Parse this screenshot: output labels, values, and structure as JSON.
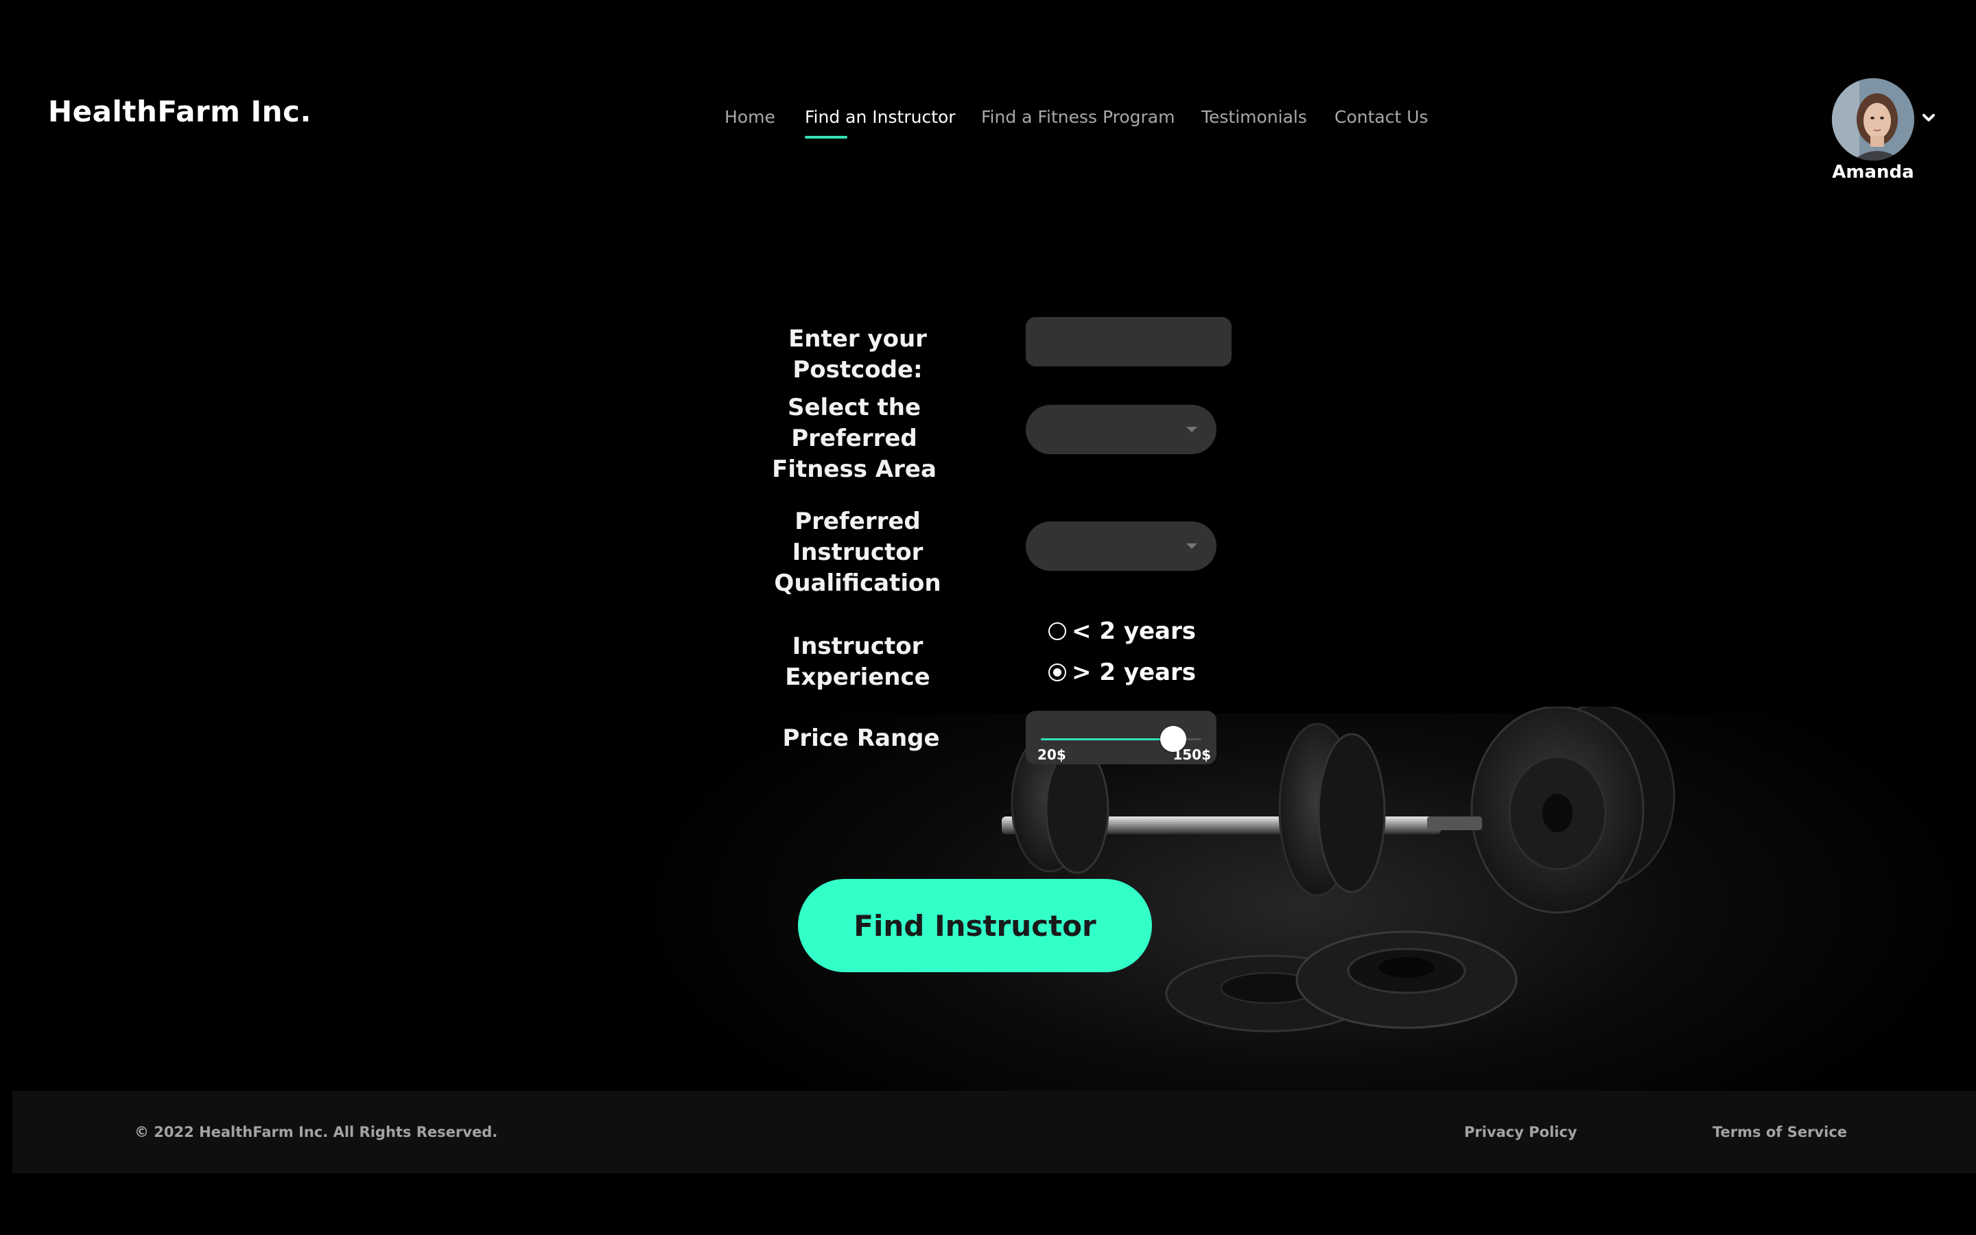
{
  "brand": {
    "name": "HealthFarm Inc."
  },
  "nav": {
    "items": [
      {
        "label": "Home",
        "active": false
      },
      {
        "label": "Find an Instructor",
        "active": true
      },
      {
        "label": "Find a Fitness Program",
        "active": false
      },
      {
        "label": "Testimonials",
        "active": false
      },
      {
        "label": "Contact Us",
        "active": false
      }
    ],
    "accent_color": "#33e0b6"
  },
  "user": {
    "name": "Amanda",
    "menu_icon": "chevron-down-icon"
  },
  "form": {
    "postcode": {
      "label": "Enter your Postcode:",
      "value": "",
      "placeholder": ""
    },
    "fitness_area": {
      "label_line1": "Select the Preferred",
      "label_line2": "Fitness Area",
      "selected": ""
    },
    "qualification": {
      "label_line1": "Preferred Instructor",
      "label_line2": "Qualification",
      "selected": ""
    },
    "experience": {
      "label": "Instructor Experience",
      "options": [
        {
          "label": "< 2 years",
          "checked": false
        },
        {
          "label": "> 2 years",
          "checked": true
        }
      ]
    },
    "price_range": {
      "label": "Price Range",
      "min_label": "20$",
      "max_label": "150$",
      "min": 20,
      "max": 150,
      "value": 127,
      "fill_color": "#33e0b6"
    },
    "submit": {
      "label": "Find Instructor",
      "color": "#33ffc9"
    }
  },
  "footer": {
    "copyright": "© 2022 HealthFarm Inc.  All Rights Reserved.",
    "links": [
      "Privacy Policy",
      "Terms of Service"
    ]
  }
}
